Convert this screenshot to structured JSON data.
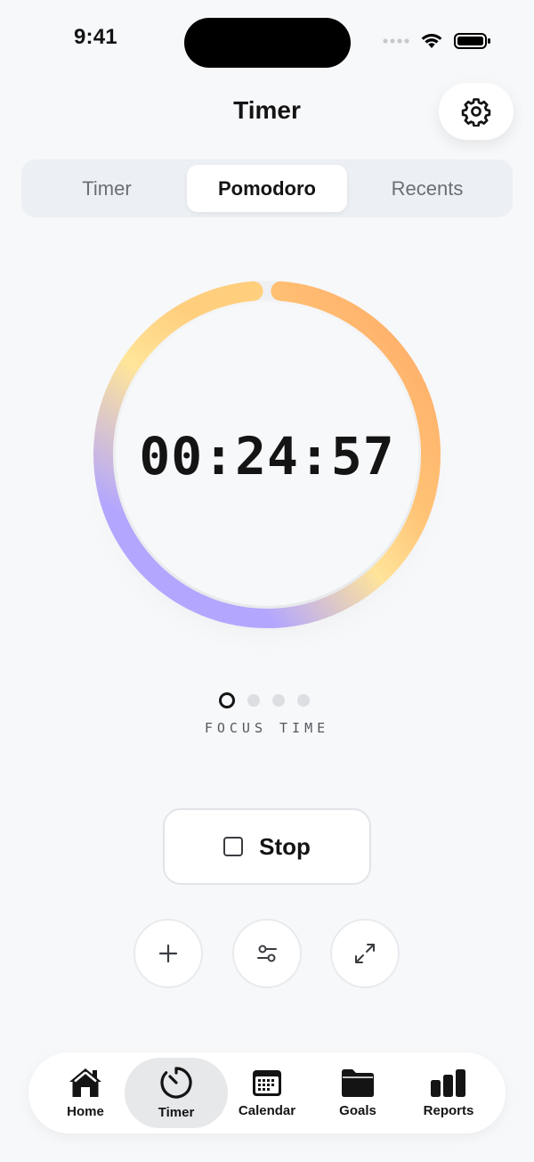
{
  "status_bar": {
    "time": "9:41"
  },
  "header": {
    "title": "Timer",
    "settings_icon": "gear-icon"
  },
  "segmented": {
    "tabs": [
      {
        "label": "Timer",
        "active": false
      },
      {
        "label": "Pomodoro",
        "active": true
      },
      {
        "label": "Recents",
        "active": false
      }
    ]
  },
  "timer": {
    "display": "00:24:57",
    "progress": 0.99,
    "gradient_colors": [
      "#ffb06a",
      "#ffd978",
      "#ffe89a",
      "#b5a7ff"
    ],
    "phase_label": "FOCUS TIME",
    "phase_index": 0,
    "phase_count": 4
  },
  "controls": {
    "stop_label": "Stop",
    "actions": [
      {
        "name": "add-icon"
      },
      {
        "name": "adjust-icon"
      },
      {
        "name": "expand-icon"
      }
    ]
  },
  "tabbar": {
    "items": [
      {
        "label": "Home",
        "icon": "home-icon"
      },
      {
        "label": "Timer",
        "icon": "timer-icon",
        "active": true
      },
      {
        "label": "Calendar",
        "icon": "calendar-icon"
      },
      {
        "label": "Goals",
        "icon": "folder-icon"
      },
      {
        "label": "Reports",
        "icon": "bar-chart-icon"
      }
    ]
  }
}
